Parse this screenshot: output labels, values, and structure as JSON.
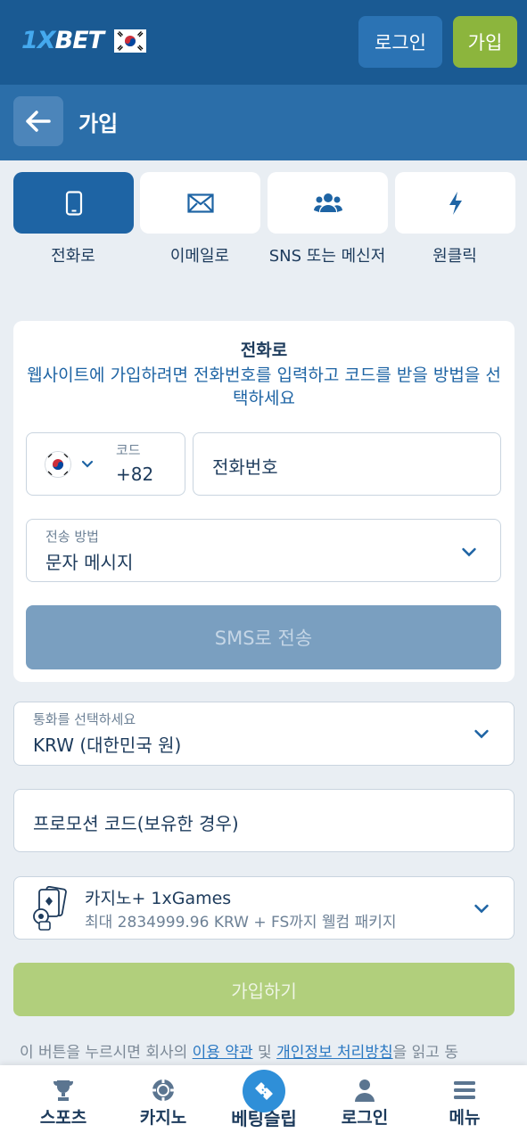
{
  "brand": {
    "logo_prefix": "1X",
    "logo_suffix": "BET"
  },
  "topbar": {
    "login_label": "로그인",
    "join_label": "가입"
  },
  "header": {
    "title": "가입"
  },
  "tabs": [
    {
      "label": "전화로",
      "icon": "phone-icon",
      "active": true
    },
    {
      "label": "이메일로",
      "icon": "envelope-icon",
      "active": false
    },
    {
      "label": "SNS 또는 메신저",
      "icon": "users-icon",
      "active": false
    },
    {
      "label": "원클릭",
      "icon": "lightning-icon",
      "active": false
    }
  ],
  "card": {
    "title": "전화로",
    "description": "웹사이트에 가입하려면 전화번호를 입력하고 코드를 받을 방법을 선택하세요",
    "code_label": "코드",
    "code_value": "+82",
    "phone_placeholder": "전화번호",
    "method_label": "전송 방법",
    "method_value": "문자 메시지",
    "sms_button": "SMS로 전송"
  },
  "currency": {
    "label": "통화를 선택하세요",
    "value": "KRW (대한민국 원)"
  },
  "promo": {
    "placeholder": "프로모션 코드(보유한 경우)"
  },
  "bonus": {
    "title": "카지노+ 1xGames",
    "subtitle": "최대 2834999.96 KRW + FS까지 웰컴 패키지"
  },
  "signup_button": "가입하기",
  "terms": {
    "prefix": "이 버튼을 누르시면 회사의 ",
    "link1": "이용 약관",
    "middle": " 및 ",
    "link2": "개인정보 처리방침",
    "suffix": "을 읽고 동"
  },
  "bottom_nav": [
    {
      "label": "스포츠",
      "icon": "trophy-icon"
    },
    {
      "label": "카지노",
      "icon": "chip-icon"
    },
    {
      "label": "베팅슬립",
      "icon": "ticket-icon"
    },
    {
      "label": "로그인",
      "icon": "user-icon"
    },
    {
      "label": "메뉴",
      "icon": "menu-icon"
    }
  ],
  "colors": {
    "primary": "#1a5a93",
    "accent_green": "#8cb53d",
    "link_blue": "#2a78c2"
  }
}
